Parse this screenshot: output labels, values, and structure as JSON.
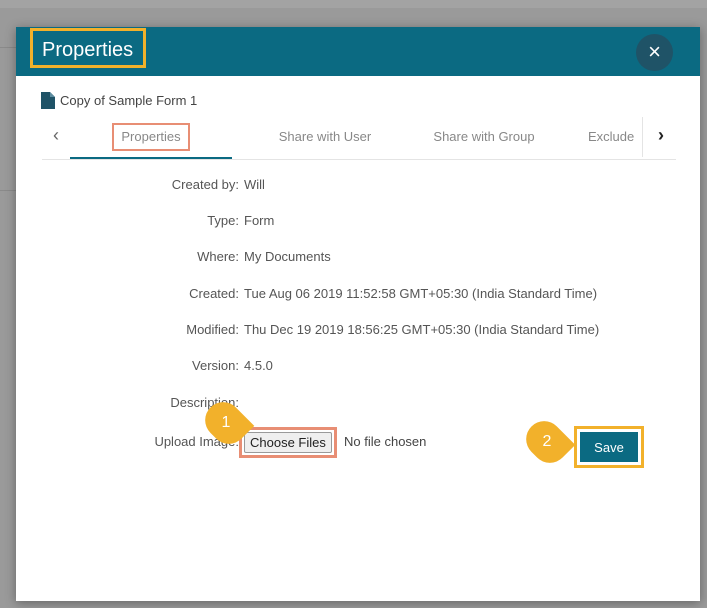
{
  "dialog": {
    "title": "Properties",
    "close_glyph": "×"
  },
  "file": {
    "icon": "document-icon",
    "name": "Copy of Sample Form 1"
  },
  "tabs": {
    "prev_glyph": "‹",
    "next_glyph": "›",
    "items": [
      {
        "label": "Properties",
        "active": true
      },
      {
        "label": "Share with User",
        "active": false
      },
      {
        "label": "Share with Group",
        "active": false
      },
      {
        "label": "Exclude",
        "active": false
      }
    ]
  },
  "properties": {
    "created_by": {
      "label": "Created by:",
      "value": "Will"
    },
    "type": {
      "label": "Type:",
      "value": "Form"
    },
    "where": {
      "label": "Where:",
      "value": "My Documents"
    },
    "created": {
      "label": "Created:",
      "value": "Tue Aug 06 2019 11:52:58 GMT+05:30 (India Standard Time)"
    },
    "modified": {
      "label": "Modified:",
      "value": "Thu Dec 19 2019 18:56:25 GMT+05:30 (India Standard Time)"
    },
    "version": {
      "label": "Version:",
      "value": "4.5.0"
    },
    "description": {
      "label": "Description:",
      "value": ""
    }
  },
  "upload": {
    "label": "Upload Image:",
    "button_label": "Choose Files",
    "status": "No file chosen"
  },
  "actions": {
    "save_label": "Save"
  },
  "callouts": [
    {
      "number": "1",
      "target": "choose-files"
    },
    {
      "number": "2",
      "target": "save"
    }
  ],
  "colors": {
    "header": "#0b6a82",
    "highlight_yellow": "#f2b12b",
    "highlight_orange": "#e88e74"
  }
}
